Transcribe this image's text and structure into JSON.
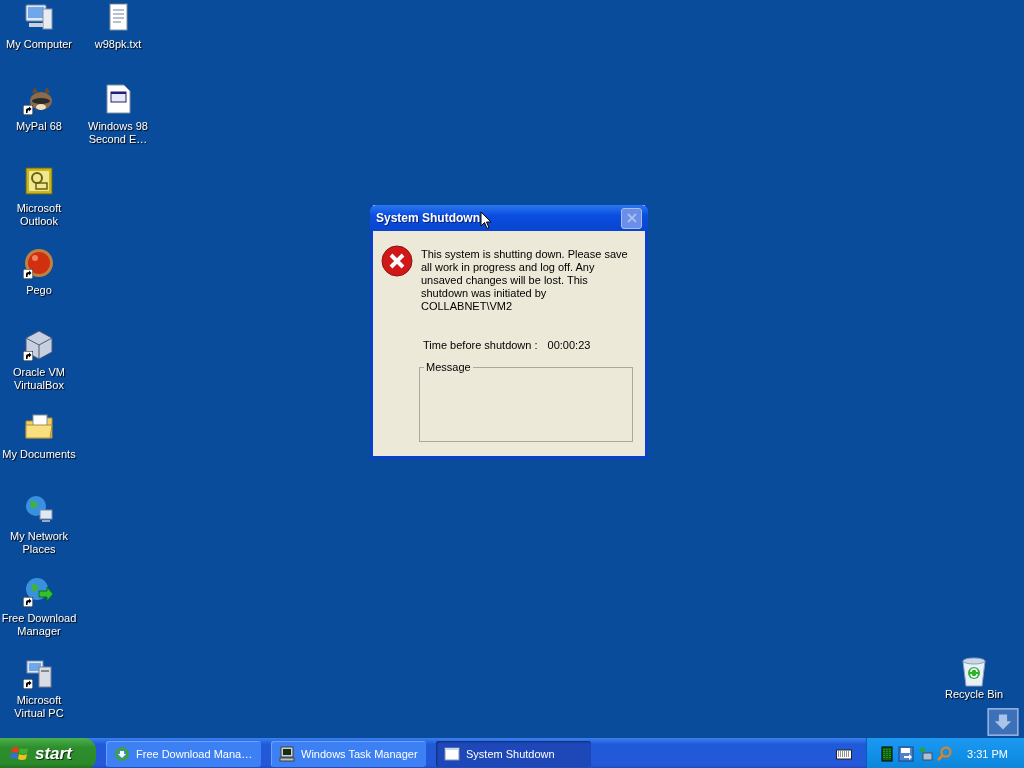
{
  "desktop": {
    "icon_columns": [
      [
        {
          "label": "My Computer",
          "kind": "computer",
          "shortcut": false
        },
        {
          "label": "MyPal 68",
          "kind": "raccoon",
          "shortcut": true
        },
        {
          "label": "Microsoft Outlook",
          "kind": "outlook",
          "shortcut": false
        },
        {
          "label": "Pego",
          "kind": "ball",
          "shortcut": true
        },
        {
          "label": "Oracle VM VirtualBox",
          "kind": "cube",
          "shortcut": true
        },
        {
          "label": "My Documents",
          "kind": "folder",
          "shortcut": false
        },
        {
          "label": "My Network Places",
          "kind": "network",
          "shortcut": false
        },
        {
          "label": "Free Download Manager",
          "kind": "download",
          "shortcut": true
        },
        {
          "label": "Microsoft Virtual PC",
          "kind": "vpc",
          "shortcut": true
        }
      ],
      [
        {
          "label": "w98pk.txt",
          "kind": "textfile",
          "shortcut": false
        },
        {
          "label": "Windows 98 Second E…",
          "kind": "document",
          "shortcut": false
        }
      ]
    ],
    "recycle_bin": {
      "label": "Recycle Bin"
    }
  },
  "dialog": {
    "title": "System Shutdown",
    "close_disabled": true,
    "message": "This system is shutting down. Please save all work in progress and log off. Any unsaved changes will be lost. This shutdown was initiated by COLLABNET\\VM2",
    "time_label": "Time before shutdown :",
    "time_value": "00:00:23",
    "group_label": "Message"
  },
  "taskbar": {
    "start": "start",
    "tasks": [
      {
        "label": "Free Download Mana…",
        "kind": "download",
        "selected": false
      },
      {
        "label": "Windows Task Manager",
        "kind": "monitor",
        "selected": false
      },
      {
        "label": "System Shutdown",
        "kind": "window",
        "selected": true
      }
    ],
    "clock": "3:31 PM"
  }
}
